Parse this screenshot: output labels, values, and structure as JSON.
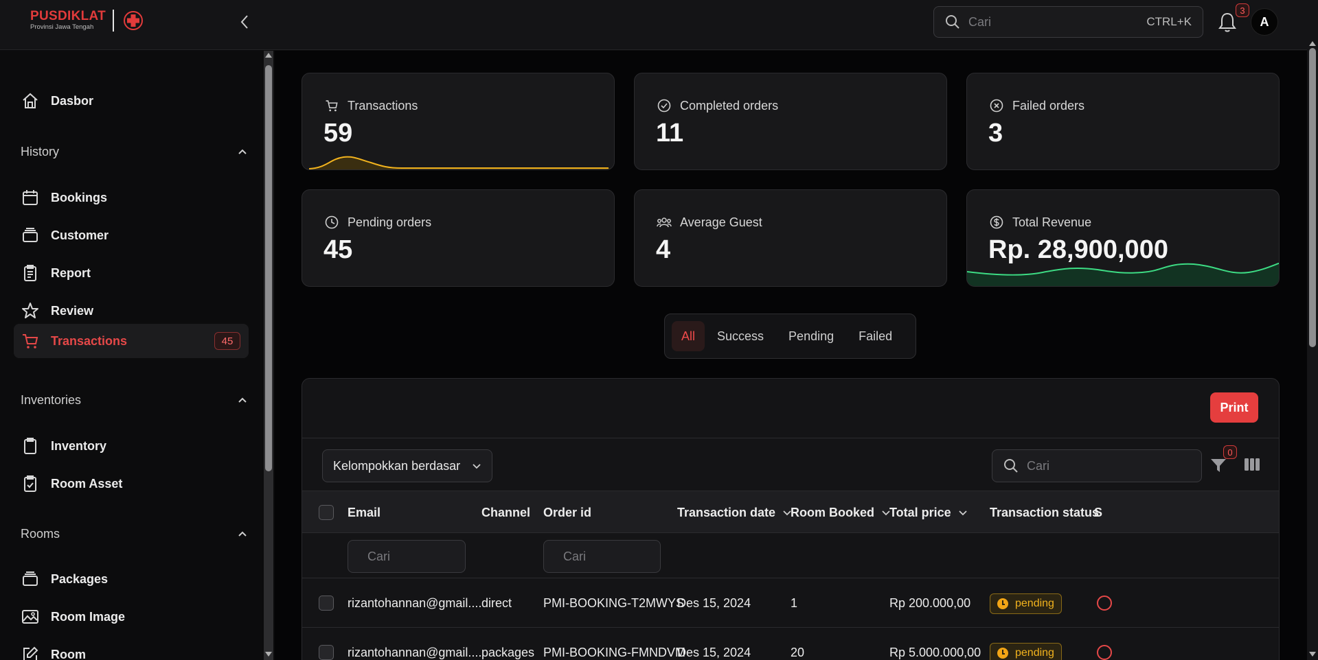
{
  "header": {
    "logo_title": "PUSDIKLAT",
    "logo_subtitle": "Provinsi Jawa Tengah",
    "search_placeholder": "Cari",
    "search_shortcut": "CTRL+K",
    "notification_count": "3",
    "avatar_initial": "A"
  },
  "sidebar": {
    "dashboard": "Dasbor",
    "sections": {
      "history": "History",
      "inventories": "Inventories",
      "rooms": "Rooms"
    },
    "items": {
      "bookings": "Bookings",
      "customer": "Customer",
      "report": "Report",
      "review": "Review",
      "transactions": "Transactions",
      "transactions_badge": "45",
      "inventory": "Inventory",
      "room_asset": "Room Asset",
      "packages": "Packages",
      "room_image": "Room Image",
      "room": "Room"
    }
  },
  "stats": [
    {
      "label": "Transactions",
      "value": "59"
    },
    {
      "label": "Completed orders",
      "value": "11"
    },
    {
      "label": "Failed orders",
      "value": "3"
    },
    {
      "label": "Pending orders",
      "value": "45"
    },
    {
      "label": "Average Guest",
      "value": "4"
    },
    {
      "label": "Total Revenue",
      "value": "Rp. 28,900,000"
    }
  ],
  "filter_tabs": [
    "All",
    "Success",
    "Pending",
    "Failed"
  ],
  "table": {
    "print_label": "Print",
    "group_by_label": "Kelompokkan berdasar",
    "search_placeholder": "Cari",
    "filter_count": "0",
    "columns": [
      "Email",
      "Channel",
      "Order id",
      "Transaction date",
      "Room Booked",
      "Total price",
      "Transaction status",
      "S"
    ],
    "column_search_placeholder": "Cari",
    "rows": [
      {
        "email": "rizantohannan@gmail....",
        "channel": "direct",
        "order_id": "PMI-BOOKING-T2MWYS",
        "date": "Des 15, 2024",
        "room_booked": "1",
        "total_price": "Rp 200.000,00",
        "status": "pending"
      },
      {
        "email": "rizantohannan@gmail....",
        "channel": "packages",
        "order_id": "PMI-BOOKING-FMNDVM",
        "date": "Des 15, 2024",
        "room_booked": "20",
        "total_price": "Rp 5.000.000,00",
        "status": "pending"
      }
    ]
  },
  "colors": {
    "accent": "#e54848",
    "transactions_spark": "#f2b31e",
    "revenue_spark": "#3ddc84",
    "pending": "#f2b31e"
  }
}
